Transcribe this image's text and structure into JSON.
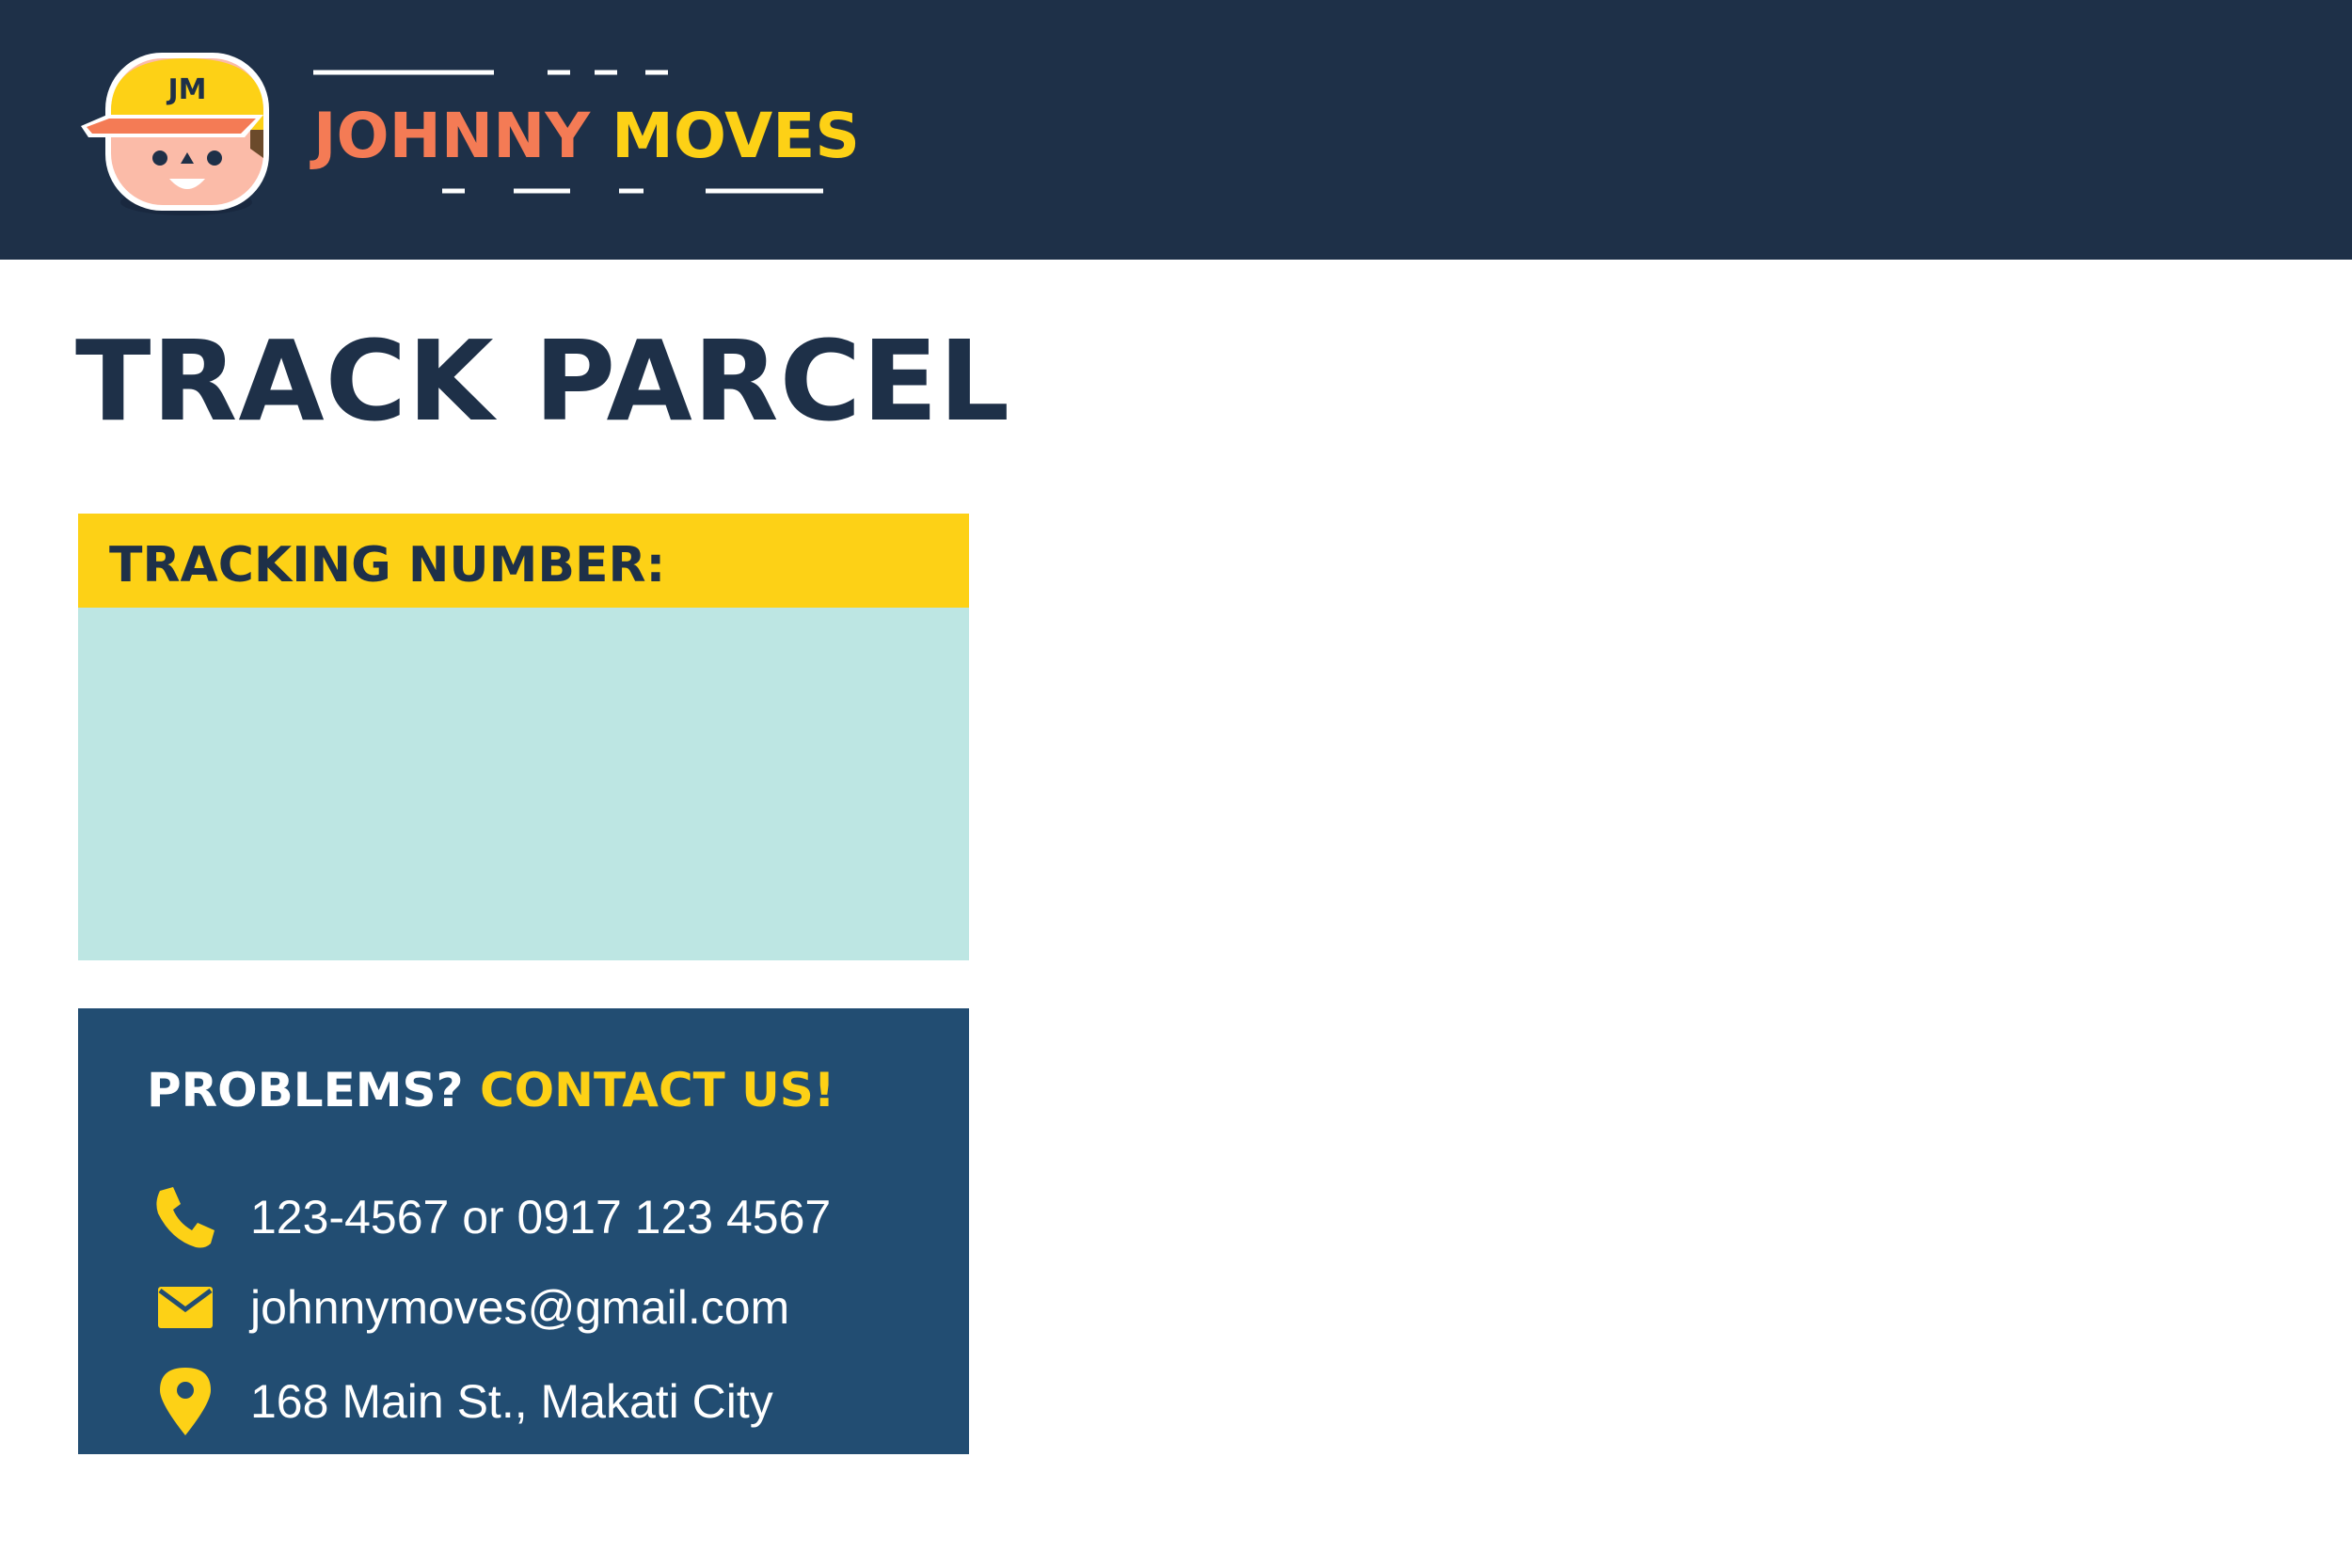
{
  "colors": {
    "header_bg": "#1e3048",
    "accent_yellow": "#fdd116",
    "accent_coral": "#f47b55",
    "input_bg": "#bde6e3",
    "contact_bg": "#224d72",
    "title_text": "#1e3048"
  },
  "header": {
    "logo": {
      "monogram": "JM",
      "icon": "delivery-mascot-logo"
    },
    "brand_first": "JOHNNY",
    "brand_last": "MOVES"
  },
  "main": {
    "title": "TRACK PARCEL",
    "tracking": {
      "label": "TRACKING NUMBER:",
      "value": "",
      "placeholder": ""
    },
    "contact": {
      "heading_question": "PROBLEMS?",
      "heading_cta": "CONTACT US!",
      "phone": {
        "icon": "phone-icon",
        "text": "123-4567 or 0917 123 4567"
      },
      "email": {
        "icon": "mail-icon",
        "text": "johnnymoves@gmail.com"
      },
      "address": {
        "icon": "map-pin-icon",
        "text": "168 Main St., Makati City"
      }
    }
  }
}
